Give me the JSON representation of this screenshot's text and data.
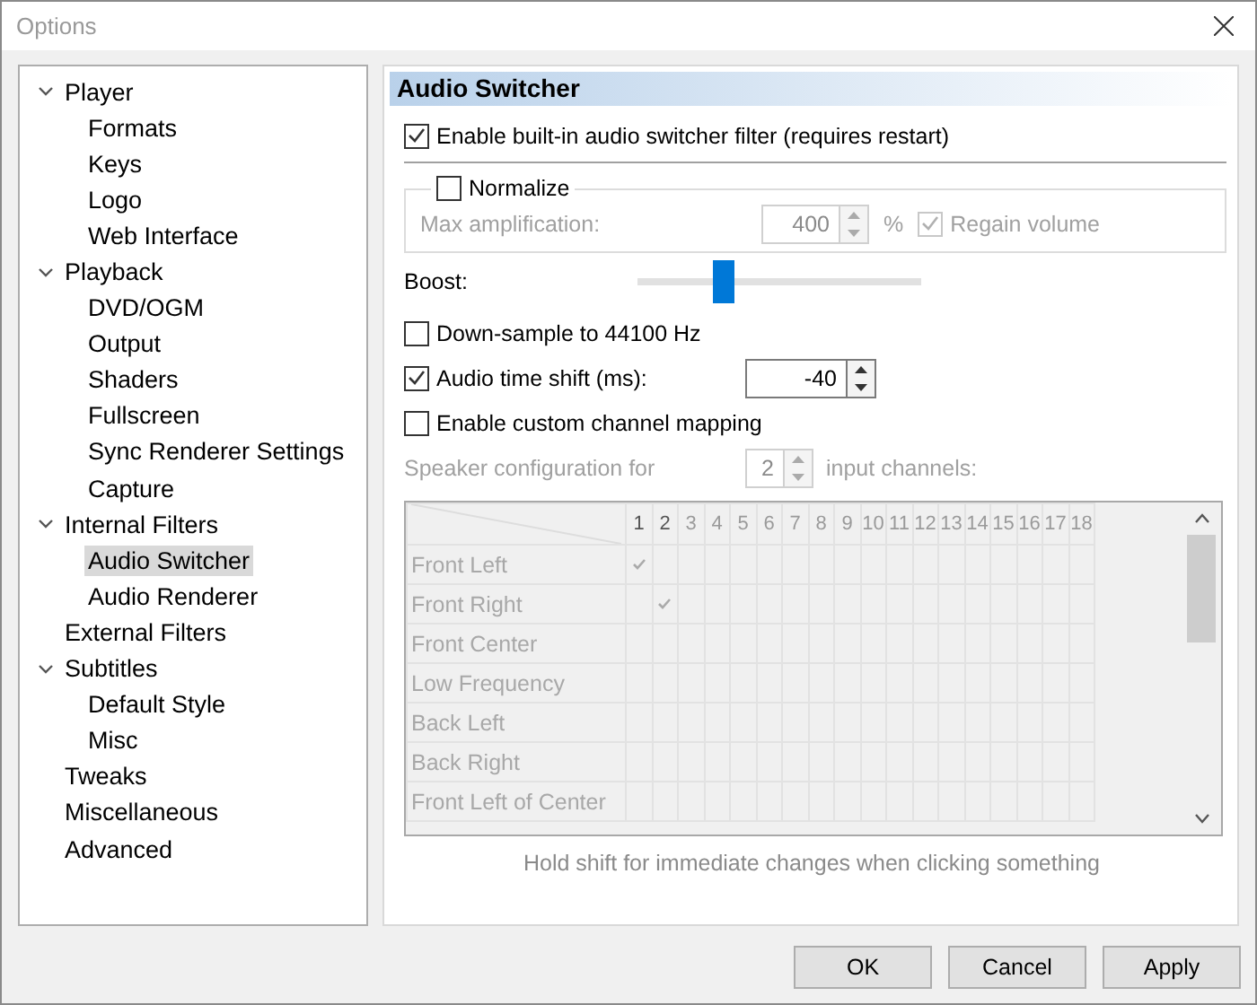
{
  "window": {
    "title": "Options"
  },
  "tree": [
    {
      "label": "Player",
      "expanded": true,
      "selected": false,
      "children": [
        {
          "label": "Formats",
          "selected": false
        },
        {
          "label": "Keys",
          "selected": false
        },
        {
          "label": "Logo",
          "selected": false
        },
        {
          "label": "Web Interface",
          "selected": false
        }
      ]
    },
    {
      "label": "Playback",
      "expanded": true,
      "selected": false,
      "children": [
        {
          "label": "DVD/OGM",
          "selected": false
        },
        {
          "label": "Output",
          "selected": false
        },
        {
          "label": "Shaders",
          "selected": false
        },
        {
          "label": "Fullscreen",
          "selected": false
        },
        {
          "label": "Sync Renderer Settings",
          "selected": false
        },
        {
          "label": "Capture",
          "selected": false
        }
      ]
    },
    {
      "label": "Internal Filters",
      "expanded": true,
      "selected": false,
      "children": [
        {
          "label": "Audio Switcher",
          "selected": true
        },
        {
          "label": "Audio Renderer",
          "selected": false
        }
      ]
    },
    {
      "label": "External Filters",
      "selected": false
    },
    {
      "label": "Subtitles",
      "expanded": true,
      "selected": false,
      "children": [
        {
          "label": "Default Style",
          "selected": false
        },
        {
          "label": "Misc",
          "selected": false
        }
      ]
    },
    {
      "label": "Tweaks",
      "selected": false
    },
    {
      "label": "Miscellaneous",
      "selected": false
    },
    {
      "label": "Advanced",
      "selected": false
    }
  ],
  "page": {
    "title": "Audio Switcher",
    "enable_filter": {
      "label": "Enable built-in audio switcher filter (requires restart)",
      "checked": true
    },
    "normalize": {
      "label": "Normalize",
      "checked": false,
      "max_label": "Max amplification:",
      "max_value": "400",
      "unit": "%",
      "regain": {
        "label": "Regain volume",
        "checked": true,
        "disabled": true
      }
    },
    "boost": {
      "label": "Boost:",
      "level": 0.3
    },
    "downsample": {
      "label": "Down-sample to 44100 Hz",
      "checked": false
    },
    "time_shift": {
      "label": "Audio time shift (ms):",
      "checked": true,
      "value": "-40"
    },
    "custom_mapping": {
      "label": "Enable custom channel mapping",
      "checked": false
    },
    "speaker": {
      "label": "Speaker configuration for",
      "value": "2",
      "suffix": "input channels:"
    },
    "matrix": {
      "columns": [
        {
          "label": "1",
          "enabled": true
        },
        {
          "label": "2",
          "enabled": true
        },
        {
          "label": "3",
          "enabled": false
        },
        {
          "label": "4",
          "enabled": false
        },
        {
          "label": "5",
          "enabled": false
        },
        {
          "label": "6",
          "enabled": false
        },
        {
          "label": "7",
          "enabled": false
        },
        {
          "label": "8",
          "enabled": false
        },
        {
          "label": "9",
          "enabled": false
        },
        {
          "label": "10",
          "enabled": false
        },
        {
          "label": "11",
          "enabled": false
        },
        {
          "label": "12",
          "enabled": false
        },
        {
          "label": "13",
          "enabled": false
        },
        {
          "label": "14",
          "enabled": false
        },
        {
          "label": "15",
          "enabled": false
        },
        {
          "label": "16",
          "enabled": false
        },
        {
          "label": "17",
          "enabled": false
        },
        {
          "label": "18",
          "enabled": false
        }
      ],
      "rows": [
        {
          "name": "Front Left",
          "cells": [
            true,
            false,
            false,
            false,
            false,
            false,
            false,
            false,
            false,
            false,
            false,
            false,
            false,
            false,
            false,
            false,
            false,
            false
          ]
        },
        {
          "name": "Front Right",
          "cells": [
            false,
            true,
            false,
            false,
            false,
            false,
            false,
            false,
            false,
            false,
            false,
            false,
            false,
            false,
            false,
            false,
            false,
            false
          ]
        },
        {
          "name": "Front Center",
          "cells": [
            false,
            false,
            false,
            false,
            false,
            false,
            false,
            false,
            false,
            false,
            false,
            false,
            false,
            false,
            false,
            false,
            false,
            false
          ]
        },
        {
          "name": "Low Frequency",
          "cells": [
            false,
            false,
            false,
            false,
            false,
            false,
            false,
            false,
            false,
            false,
            false,
            false,
            false,
            false,
            false,
            false,
            false,
            false
          ]
        },
        {
          "name": "Back Left",
          "cells": [
            false,
            false,
            false,
            false,
            false,
            false,
            false,
            false,
            false,
            false,
            false,
            false,
            false,
            false,
            false,
            false,
            false,
            false
          ]
        },
        {
          "name": "Back Right",
          "cells": [
            false,
            false,
            false,
            false,
            false,
            false,
            false,
            false,
            false,
            false,
            false,
            false,
            false,
            false,
            false,
            false,
            false,
            false
          ]
        },
        {
          "name": "Front Left of Center",
          "cells": [
            false,
            false,
            false,
            false,
            false,
            false,
            false,
            false,
            false,
            false,
            false,
            false,
            false,
            false,
            false,
            false,
            false,
            false
          ]
        }
      ]
    },
    "hint": "Hold shift for immediate changes when clicking something"
  },
  "buttons": [
    "OK",
    "Cancel",
    "Apply"
  ]
}
